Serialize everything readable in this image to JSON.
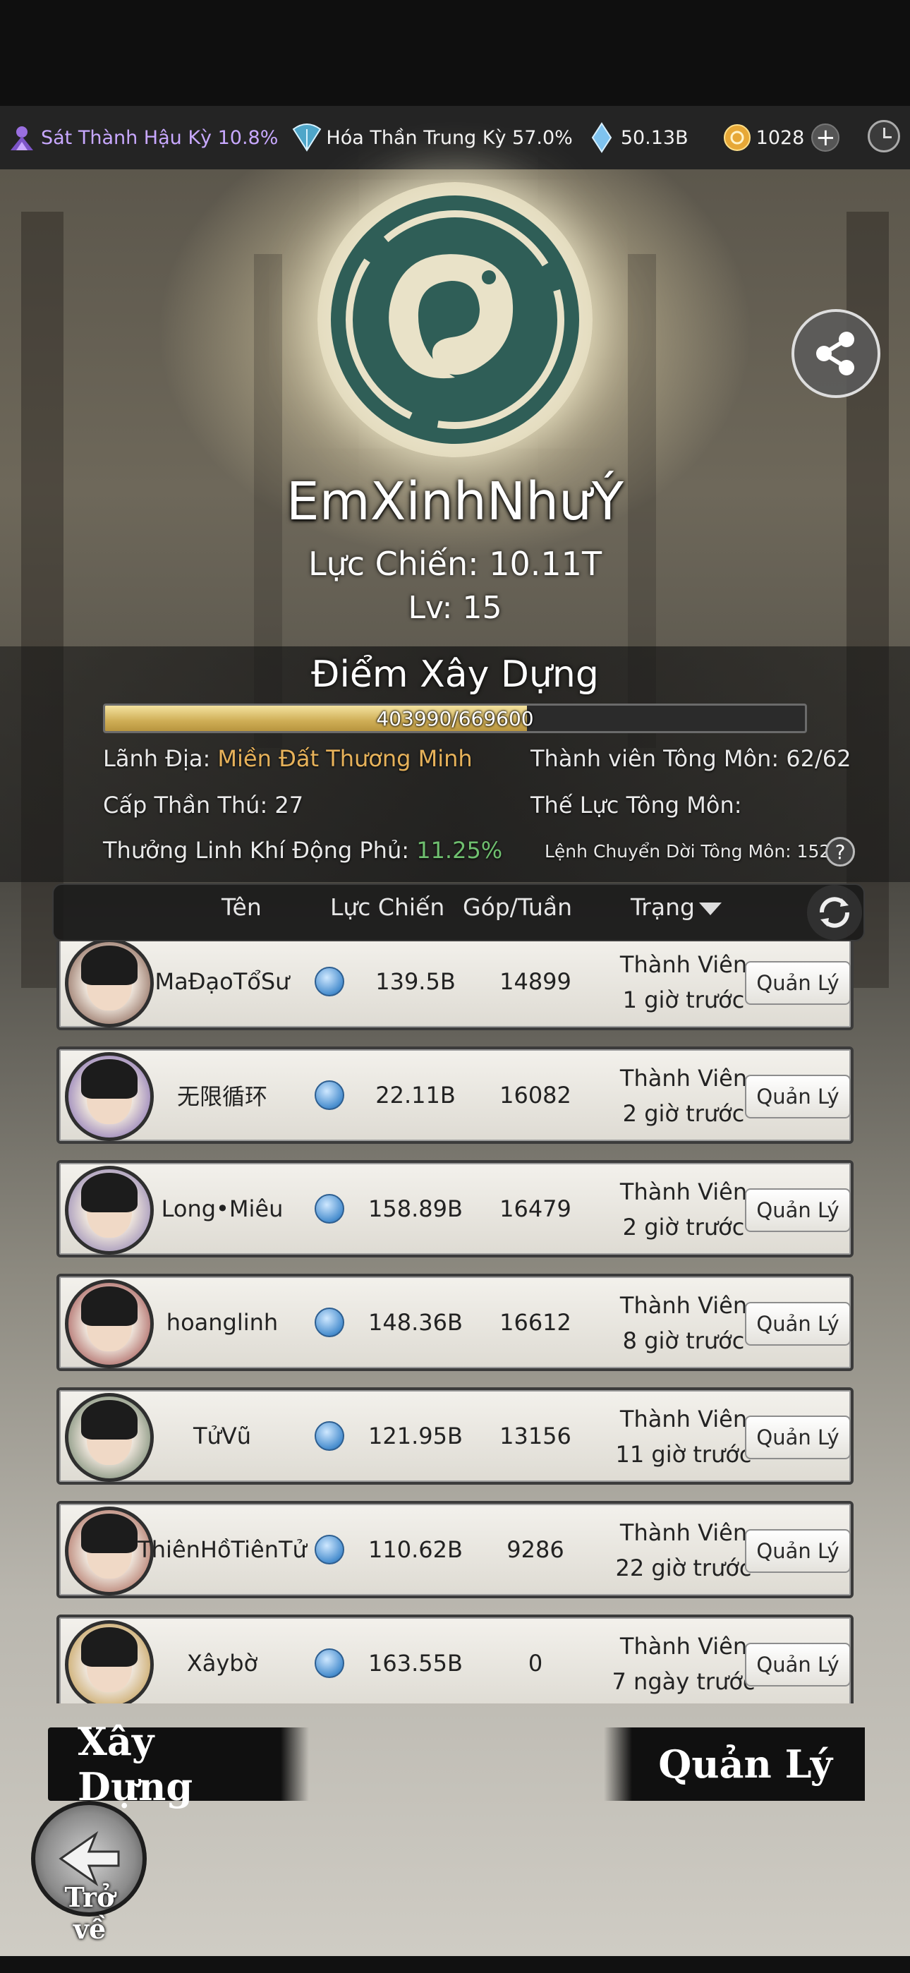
{
  "top_bar": {
    "stat1_text": "Sát Thành Hậu Kỳ 10.8%",
    "stat2_text": "Hóa Thần Trung Kỳ 57.0%",
    "stat3_text": "50.13B",
    "stat4_text": "1028",
    "plus_label": "+"
  },
  "guild": {
    "name": "EmXinhNhưÝ",
    "power": "Lực Chiến: 10.11T",
    "level": "Lv: 15",
    "build_points_title": "Điểm Xây Dựng",
    "build_points_text": "403990/669600",
    "build_points_fraction": 0.6033,
    "territory_label": "Lãnh Địa:",
    "territory_value": "Miền Đất Thương Minh",
    "members_label": "Thành viên Tông Môn: 62/62",
    "beast_level": "Cấp Thần Thú: 27",
    "guild_force_label": "Thế Lực Tông Môn:",
    "reward_label": "Thưởng Linh Khí Động Phủ:",
    "reward_value": "11.25%",
    "relocate_label": "Lệnh Chuyển Dời Tông Môn: 152",
    "help_label": "?"
  },
  "table": {
    "col_name": "Tên",
    "col_power": "Lực Chiến",
    "col_contrib": "Góp/Tuần",
    "col_status": "Trạng",
    "rows": [
      {
        "name": "MaĐạoTổSư",
        "power": "139.5B",
        "contrib": "14899",
        "role": "Thành Viên",
        "last_seen": "1 giờ trước",
        "action": "Quản Lý"
      },
      {
        "name": "无限循环",
        "power": "22.11B",
        "contrib": "16082",
        "role": "Thành Viên",
        "last_seen": "2 giờ trước",
        "action": "Quản Lý"
      },
      {
        "name": "Long•Miêu",
        "power": "158.89B",
        "contrib": "16479",
        "role": "Thành Viên",
        "last_seen": "2 giờ trước",
        "action": "Quản Lý"
      },
      {
        "name": "hoanglinh",
        "power": "148.36B",
        "contrib": "16612",
        "role": "Thành Viên",
        "last_seen": "8 giờ trước",
        "action": "Quản Lý"
      },
      {
        "name": "TửVũ",
        "power": "121.95B",
        "contrib": "13156",
        "role": "Thành Viên",
        "last_seen": "11 giờ trước",
        "action": "Quản Lý"
      },
      {
        "name": "ThiênHồTiênTử",
        "power": "110.62B",
        "contrib": "9286",
        "role": "Thành Viên",
        "last_seen": "22 giờ trước",
        "action": "Quản Lý"
      },
      {
        "name": "Xâybờ",
        "power": "163.55B",
        "contrib": "0",
        "role": "Thành Viên",
        "last_seen": "7 ngày trước",
        "action": "Quản Lý"
      }
    ]
  },
  "footer": {
    "build_button": "Xây Dựng",
    "manage_button": "Quản Lý",
    "back_label": "Trở về"
  },
  "icons": {
    "stat1": "purple-realm-icon",
    "stat2": "fan-realm-icon",
    "stat3": "crystal-icon",
    "stat4": "gold-coin-icon",
    "clock": "clock-icon",
    "share": "share-icon",
    "refresh": "refresh-icon",
    "back": "back-arrow-icon",
    "power": "power-orb-icon"
  },
  "colors": {
    "purple_text": "#c8a8ff",
    "gold_text": "#e7b25a",
    "green_text": "#6fbf6f",
    "emblem_green": "#2f5e57"
  }
}
